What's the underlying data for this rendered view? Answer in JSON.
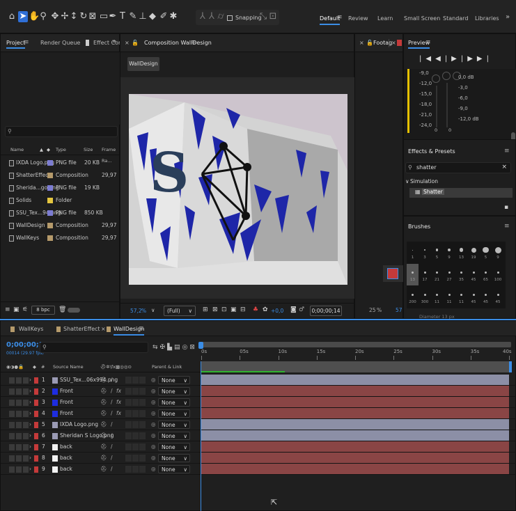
{
  "toolbar": {
    "snapping_label": "Snapping",
    "workspaces": [
      "Default",
      "Review",
      "Learn",
      "Small Screen",
      "Standard",
      "Libraries"
    ],
    "more": "»"
  },
  "project_panel": {
    "tabs": [
      "Project",
      "Render Queue",
      "Effect Cor"
    ],
    "more": "»",
    "search_placeholder": "",
    "columns": [
      "Name",
      "Type",
      "Size",
      "Frame Ra..."
    ],
    "items": [
      {
        "name": "IXDA Logo.png",
        "type": "PNG file",
        "size": "20 KB",
        "fps": "",
        "color": "#7c7cd2"
      },
      {
        "name": "ShatterEffect",
        "type": "Composition",
        "size": "",
        "fps": "29,97",
        "color": "#b59a6b"
      },
      {
        "name": "Sherida...go.png",
        "type": "PNG file",
        "size": "19 KB",
        "fps": "",
        "color": "#7c7cd2"
      },
      {
        "name": "Solids",
        "type": "Folder",
        "size": "",
        "fps": "",
        "color": "#e4c640"
      },
      {
        "name": "SSU_Tex...94.png",
        "type": "PNG file",
        "size": "850 KB",
        "fps": "",
        "color": "#7c7cd2"
      },
      {
        "name": "WallDesign",
        "type": "Composition",
        "size": "",
        "fps": "29,97",
        "color": "#b59a6b"
      },
      {
        "name": "WallKeys",
        "type": "Composition",
        "size": "",
        "fps": "29,97",
        "color": "#b59a6b"
      }
    ],
    "bpc": "8 bpc"
  },
  "composition_panel": {
    "tab_title": "Composition WallDesign",
    "breadcrumb": "WallDesign",
    "zoom": "57,2",
    "zoom_unit": "%",
    "resolution": "(Full)",
    "exposure": "+0,0",
    "timecode": "0;00;00;14"
  },
  "footage_panel": {
    "tab": "Footag",
    "zoom": "25",
    "zoom_unit": "%",
    "zoom2": "57"
  },
  "preview_panel": {
    "title": "Preview",
    "db_left": [
      "-9,0",
      "-12,0",
      "-15,0",
      "-18,0",
      "-21,0",
      "-24,0"
    ],
    "db_right": [
      "0,0 dB",
      "-3,0",
      "-6,0",
      "-9,0",
      "-12,0 dB"
    ],
    "zeros": [
      "0",
      "0"
    ]
  },
  "effects_panel": {
    "title": "Effects & Presets",
    "search_value": "shatter",
    "category": "Simulation",
    "effect": "Shatter"
  },
  "brushes_panel": {
    "title": "Brushes",
    "sizes_row1": [
      "1",
      "3",
      "5",
      "9",
      "13",
      "19",
      "5",
      "9"
    ],
    "sizes_row2": [
      "13",
      "17",
      "21",
      "27",
      "35",
      "45",
      "65",
      "100"
    ],
    "sizes_row3": [
      "200",
      "300",
      "11",
      "11",
      "11",
      "45",
      "45",
      "45"
    ],
    "footer": "Diameter 13 px"
  },
  "timeline": {
    "tabs": [
      "WallKeys",
      "ShatterEffect",
      "WallDesign"
    ],
    "timecode": "0;00;00;14",
    "fps": "00014 (29.97 fps)",
    "col_source": "Source Name",
    "col_parent": "Parent & Link",
    "ruler": [
      "0s",
      "05s",
      "10s",
      "15s",
      "20s",
      "25s",
      "30s",
      "35s",
      "40s"
    ],
    "layers": [
      {
        "num": "1",
        "name": "SSU_Tex...06x994.png",
        "color": "#9a9ab4",
        "parent": "None",
        "bar": "#8c8fa6",
        "fx": false
      },
      {
        "num": "2",
        "name": "Front",
        "color": "#1e2de0",
        "parent": "None",
        "bar": "#8a4545",
        "fx": true
      },
      {
        "num": "3",
        "name": "Front",
        "color": "#1e2de0",
        "parent": "None",
        "bar": "#8a4545",
        "fx": true
      },
      {
        "num": "4",
        "name": "Front",
        "color": "#1e2de0",
        "parent": "None",
        "bar": "#8a4545",
        "fx": true
      },
      {
        "num": "5",
        "name": "IXDA Logo.png",
        "color": "#9a9ab4",
        "parent": "None",
        "bar": "#8c8fa6",
        "fx": false
      },
      {
        "num": "6",
        "name": "Sheridan S Logo.png",
        "color": "#9a9ab4",
        "parent": "None",
        "bar": "#8c8fa6",
        "fx": false
      },
      {
        "num": "7",
        "name": "back",
        "color": "#f2f2f2",
        "parent": "None",
        "bar": "#8a4545",
        "fx": false
      },
      {
        "num": "8",
        "name": "back",
        "color": "#f2f2f2",
        "parent": "None",
        "bar": "#8a4545",
        "fx": false
      },
      {
        "num": "9",
        "name": "back",
        "color": "#f2f2f2",
        "parent": "None",
        "bar": "#8a4545",
        "fx": false
      }
    ]
  },
  "colors": {
    "accent": "#3b8de6",
    "layer_red": "#c43a3a",
    "bar_gray": "#8c8fa6",
    "bar_red": "#8a4545"
  }
}
